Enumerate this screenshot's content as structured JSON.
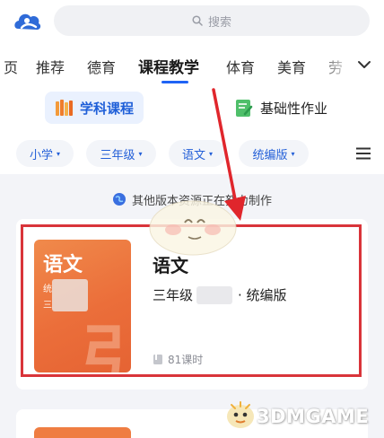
{
  "search": {
    "placeholder": "搜索"
  },
  "nav": {
    "tabs": [
      "页",
      "推荐",
      "德育",
      "课程教学",
      "体育",
      "美育",
      "劳"
    ],
    "active": "课程教学"
  },
  "course_types": {
    "primary": "学科课程",
    "secondary": "基础性作业"
  },
  "filters": [
    {
      "label": "小学",
      "caret": "▾"
    },
    {
      "label": "三年级",
      "caret": "▾"
    },
    {
      "label": "语文",
      "caret": "▾"
    },
    {
      "label": "统编版",
      "caret": "▾"
    }
  ],
  "notice": {
    "text": "其他版本资源正在努力制作"
  },
  "course": {
    "cover_title": "语文",
    "cover_line1": "统",
    "cover_line2": "三",
    "cover_big": "引",
    "name": "语文",
    "grade": "三年级",
    "edition": "· 统编版",
    "lessons": "81课时"
  },
  "watermark": {
    "text": "3DMGAME"
  },
  "colors": {
    "accent": "#1f63f5",
    "highlight_box": "#d9343a",
    "cover": "#eb6e3a",
    "page_bg": "#f3f4f8"
  },
  "icons": [
    "app-logo-icon",
    "search-icon",
    "chevron-down-icon",
    "books-icon",
    "homework-icon",
    "menu-icon",
    "globe-icon",
    "book-icon"
  ]
}
